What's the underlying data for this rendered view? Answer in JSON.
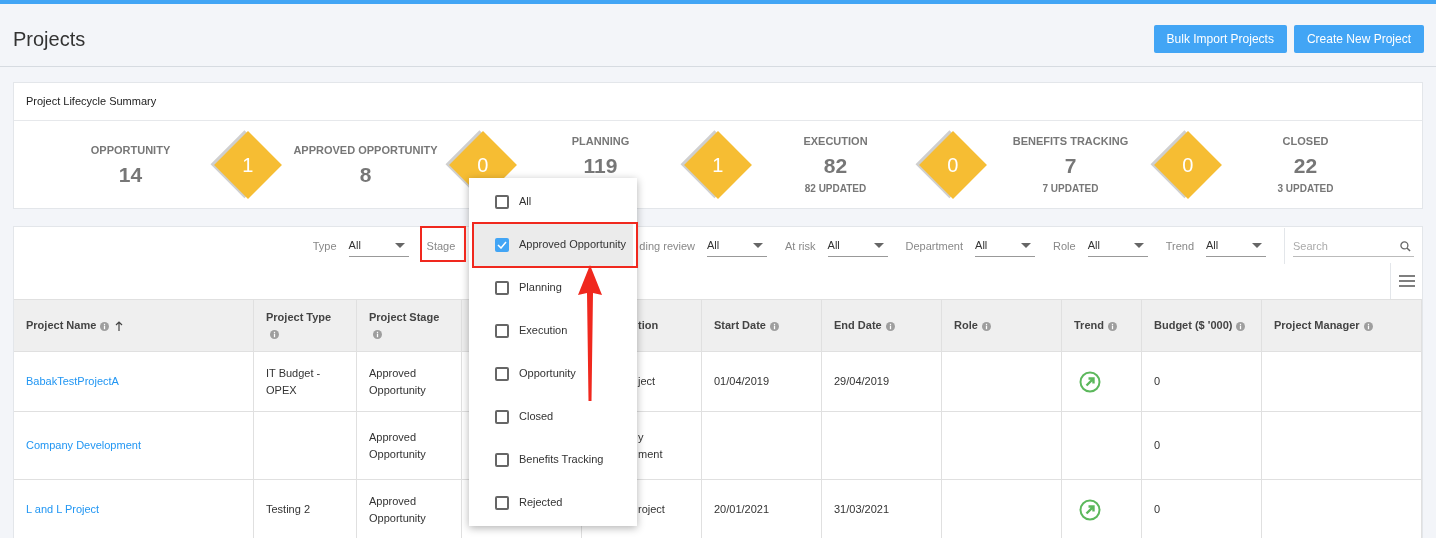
{
  "page": {
    "title": "Projects",
    "buttons": [
      "Bulk Import Projects",
      "Create New Project"
    ]
  },
  "summary": {
    "title": "Project Lifecycle Summary",
    "stages": [
      {
        "label": "OPPORTUNITY",
        "count": "14"
      },
      {
        "label": "APPROVED OPPORTUNITY",
        "count": "8"
      },
      {
        "label": "PLANNING",
        "count": "119",
        "footer_covered": true
      },
      {
        "label": "EXECUTION",
        "count": "82",
        "updated": "82 UPDATED"
      },
      {
        "label": "BENEFITS TRACKING",
        "count": "7",
        "updated": "7 UPDATED"
      },
      {
        "label": "CLOSED",
        "count": "22",
        "updated": "3 UPDATED"
      }
    ],
    "transitions": [
      "1",
      "0",
      "1",
      "0",
      "0"
    ]
  },
  "filters": [
    {
      "label": "Type",
      "value": "All"
    },
    {
      "label": "Stage"
    },
    {
      "label": "ding review",
      "value": "All"
    },
    {
      "label": "At risk",
      "value": "All"
    },
    {
      "label": "Department",
      "value": "All"
    },
    {
      "label": "Role",
      "value": "All"
    },
    {
      "label": "Trend",
      "value": "All"
    }
  ],
  "search": {
    "placeholder": "Search"
  },
  "stage_menu": [
    {
      "label": "All",
      "checked": false,
      "selected": false
    },
    {
      "label": "Approved Opportunity",
      "checked": true,
      "selected": true
    },
    {
      "label": "Planning",
      "checked": false,
      "selected": false
    },
    {
      "label": "Execution",
      "checked": false,
      "selected": false
    },
    {
      "label": "Opportunity",
      "checked": false,
      "selected": false
    },
    {
      "label": "Closed",
      "checked": false,
      "selected": false
    },
    {
      "label": "Benefits Tracking",
      "checked": false,
      "selected": false
    },
    {
      "label": "Rejected",
      "checked": false,
      "selected": false
    }
  ],
  "table": {
    "columns": [
      {
        "label": "Project Name",
        "sorted": true
      },
      {
        "label": "Project Type"
      },
      {
        "label": "Project Stage"
      },
      {},
      {
        "label": "tion"
      },
      {
        "label": "Start Date"
      },
      {
        "label": "End Date"
      },
      {
        "label": "Role"
      },
      {
        "label": "Trend"
      },
      {
        "label": "Budget ($ '000)"
      },
      {
        "label": "Project Manager"
      }
    ],
    "rows": [
      {
        "name": "BabakTestProjectA",
        "type": "IT Budget - OPEX",
        "stage": "Approved Opportunity",
        "column_5": "ject",
        "start_date": "01/04/2019",
        "end_date": "29/04/2019",
        "trend_up": true,
        "budget": "0"
      },
      {
        "name": "Company Development",
        "stage": "Approved Opportunity",
        "column_5": "y\nment",
        "trend_up": false,
        "budget": "0"
      },
      {
        "name": "L and L Project",
        "type": "Testing 2",
        "stage": "Approved Opportunity",
        "column_5": "roject",
        "start_date": "20/01/2021",
        "end_date": "31/03/2021",
        "trend_up": true,
        "budget": "0"
      }
    ]
  }
}
